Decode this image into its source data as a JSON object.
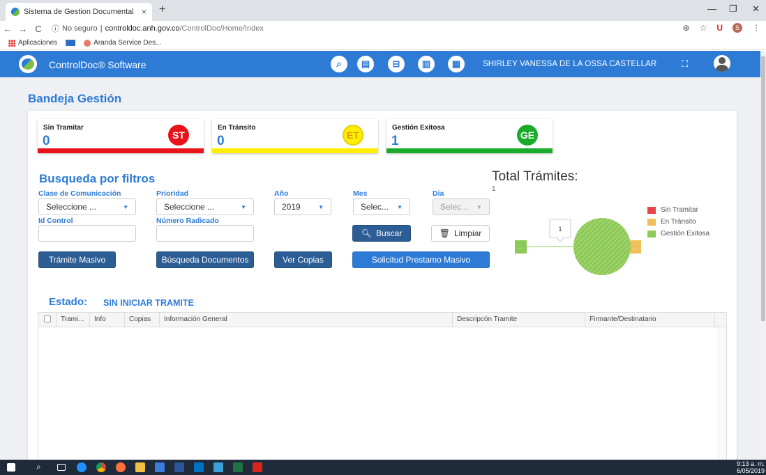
{
  "browser": {
    "tab_title": "Sistema de Gestion Documental",
    "tab_close": "×",
    "new_tab": "+",
    "url_security": "No seguro",
    "url_host": "controldoc.anh.gov.co",
    "url_path": "/ControlDoc/Home/Index",
    "profile_initial": "S",
    "bookmarks": [
      {
        "label": "Aplicaciones"
      },
      {
        "label": ""
      },
      {
        "label": "Aranda Service Des..."
      }
    ]
  },
  "app": {
    "brand": "ControlDoc® Software",
    "user_name": "SHIRLEY VANESSA DE LA OSSA CASTELLAR",
    "header_icons": [
      "search-icon",
      "document-search-icon",
      "inbox-icon",
      "archive-icon",
      "report-icon"
    ]
  },
  "page": {
    "title": "Bandeja Gestión",
    "cards": [
      {
        "label": "Sin Tramitar",
        "count": "0",
        "badge": "ST",
        "color": "#e8141a"
      },
      {
        "label": "En Tránsito",
        "count": "0",
        "badge": "ET",
        "color": "#ffee00"
      },
      {
        "label": "Gestión Exitosa",
        "count": "1",
        "badge": "GE",
        "color": "#1aab2a"
      }
    ],
    "filters": {
      "title": "Busqueda por filtros",
      "clase_label": "Clase de Comunicación",
      "clase_value": "Seleccione ...",
      "prioridad_label": "Prioridad",
      "prioridad_value": "Seleccione ...",
      "anio_label": "Año",
      "anio_value": "2019",
      "mes_label": "Mes",
      "mes_value": "Selec...",
      "dia_label": "Dia",
      "dia_value": "Selec...",
      "id_control_label": "Id Control",
      "numero_radicado_label": "Número Radicado",
      "buscar": "Buscar",
      "limpiar": "Limpiar"
    },
    "actions": {
      "tramite_masivo": "Trámite Masivo",
      "busqueda_documentos": "Búsqueda Documentos",
      "ver_copias": "Ver Copias",
      "solicitud_prestamo": "Solicitud Prestamo Masivo"
    },
    "estado": {
      "label": "Estado:",
      "value": "SIN INICIAR TRAMITE"
    },
    "table_headers": [
      "Trami...",
      "Info",
      "Copias",
      "Información General",
      "Descripcón Tramite",
      "Firmante/Destinatario"
    ]
  },
  "chart_data": {
    "type": "pie",
    "title": "Total Trámites:",
    "subtitle": "1",
    "categories": [
      "Sin Tramitar",
      "En Tránsito",
      "Gestión Exitosa"
    ],
    "values": [
      0,
      0,
      1
    ],
    "colors": [
      "#e8434a",
      "#f0c05a",
      "#8dc956"
    ],
    "tooltip": "1",
    "side_labels": [
      "...",
      "..."
    ],
    "legend_position": "right"
  },
  "taskbar": {
    "time": "9:13 a. m.",
    "date": "6/05/2019"
  }
}
